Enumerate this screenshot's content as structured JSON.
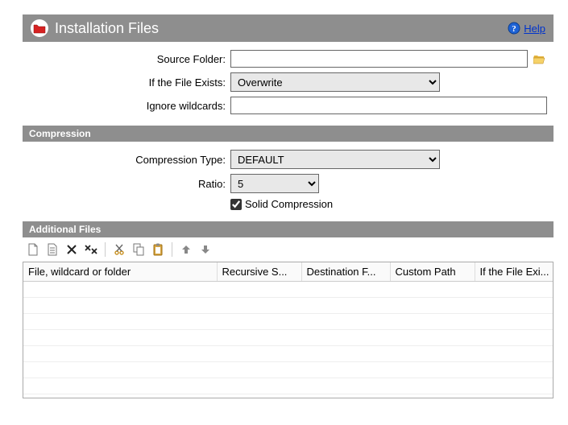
{
  "header": {
    "title": "Installation Files",
    "help_label": "Help"
  },
  "form": {
    "source_folder_label": "Source Folder:",
    "source_folder_value": "",
    "file_exists_label": "If the File Exists:",
    "file_exists_value": "Overwrite",
    "ignore_wildcards_label": "Ignore wildcards:",
    "ignore_wildcards_value": ""
  },
  "compression": {
    "section_title": "Compression",
    "type_label": "Compression Type:",
    "type_value": "DEFAULT",
    "ratio_label": "Ratio:",
    "ratio_value": "5",
    "solid_label": "Solid Compression",
    "solid_checked": true
  },
  "additional": {
    "section_title": "Additional Files",
    "columns": {
      "c1": "File, wildcard or folder",
      "c2": "Recursive S...",
      "c3": "Destination F...",
      "c4": "Custom Path",
      "c5": "If the File Exi..."
    }
  }
}
